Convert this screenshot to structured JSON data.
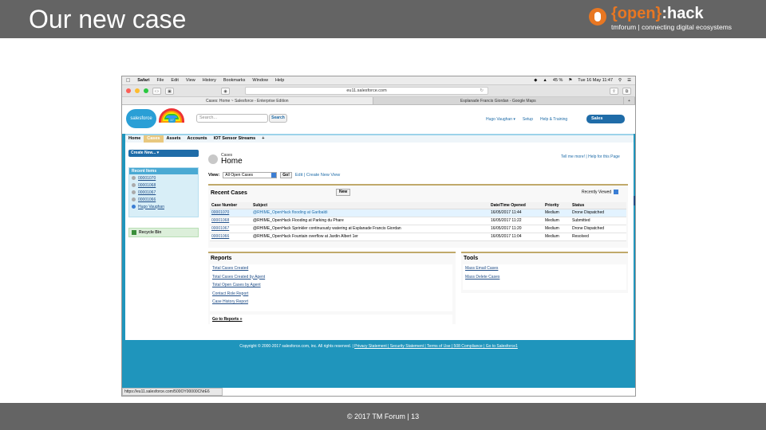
{
  "slide": {
    "title": "Our new case",
    "logo_open": "{open}",
    "logo_hack": ":hack",
    "logo_tagline": "tmforum | connecting digital ecosystems",
    "footer": "© 2017  TM  Forum    |    13"
  },
  "mac": {
    "menu": [
      "Safari",
      "File",
      "Edit",
      "View",
      "History",
      "Bookmarks",
      "Window",
      "Help"
    ],
    "battery": "45 %",
    "clock": "Tue 16 May  11:47"
  },
  "browser": {
    "url": "eu11.salesforce.com",
    "tabs": [
      "Cases: Home ~ Salesforce - Enterprise Edition",
      "Esplanade Francis Giordan - Google Maps"
    ],
    "status_url": "https://eu11.salesforce.com/500OY00000CNrE6"
  },
  "sf": {
    "logo": "salesforce",
    "badge": "17",
    "search_placeholder": "Search...",
    "search_btn": "Search",
    "user": "Hugo Vaughan",
    "setup": "Setup",
    "help_training": "Help & Training",
    "app": "Sales",
    "nav": [
      "Home",
      "Cases",
      "Assets",
      "Accounts",
      "IOT Sensor Streams",
      "+"
    ],
    "create_new": "Create New...",
    "recent_items_title": "Recent Items",
    "recent_items": [
      "00001070",
      "00001068",
      "00001067",
      "00001066",
      "Hugo Vaughan"
    ],
    "recycle_bin": "Recycle Bin",
    "page_type": "Cases",
    "page_title": "Home",
    "help_links": "Tell me more! | Help for this Page",
    "view_label": "View:",
    "view_value": "All Open Cases",
    "go": "Go!",
    "edit_create": "Edit | Create New View",
    "recent_cases_title": "Recent Cases",
    "new_btn": "New",
    "recently_viewed": "Recently Viewed",
    "columns": [
      "Case Number",
      "Subject",
      "Date/Time Opened",
      "Priority",
      "Status"
    ],
    "rows": [
      [
        "00001070",
        "@RHIME_OpenHack flooding at Garibaldi",
        "16/05/2017 11:44",
        "Medium",
        "Drone Dispatched"
      ],
      [
        "00001068",
        "@RHIME_OpenHack Flooding at Parking du Phare",
        "16/05/2017 11:22",
        "Medium",
        "Submitted"
      ],
      [
        "00001067",
        "@RHIME_OpenHack Sprinkler continuously watering at Esplanade Francis Giordan",
        "16/05/2017 11:20",
        "Medium",
        "Drone Dispatched"
      ],
      [
        "00001066",
        "@RHIME_OpenHack Fountain overflow at Jardin Albert 1er",
        "16/05/2017 11:04",
        "Medium",
        "Resolved"
      ]
    ],
    "reports_title": "Reports",
    "reports": [
      "Total Cases Created",
      "Total Cases Created by Agent",
      "Total Open Cases by Agent",
      "Contact Role Report",
      "Case History Report"
    ],
    "go_reports": "Go to Reports »",
    "tools_title": "Tools",
    "tools": [
      "Mass Email Cases",
      "Mass Delete Cases"
    ],
    "copyright": "Copyright © 2000-2017 salesforce.com, inc. All rights reserved. | ",
    "footer_links": "Privacy Statement | Security Statement | Terms of Use | 508 Compliance | Go to Salesforce1"
  }
}
